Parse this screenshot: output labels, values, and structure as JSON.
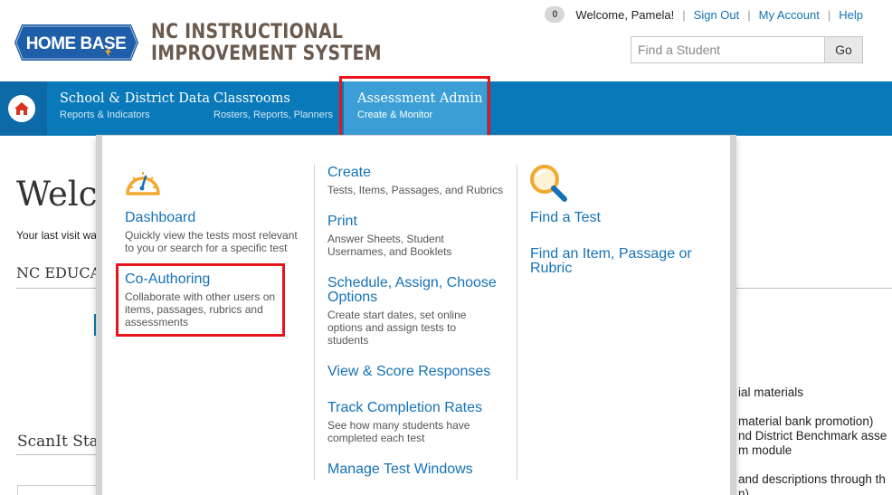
{
  "header": {
    "logo_text": "HOME BASE",
    "system_title_line1": "NC INSTRUCTIONAL",
    "system_title_line2": "IMPROVEMENT SYSTEM",
    "notification_count": "0",
    "welcome_text": "Welcome, Pamela!",
    "links": {
      "sign_out": "Sign Out",
      "my_account": "My Account",
      "help": "Help"
    },
    "separator": "|",
    "search": {
      "placeholder": "Find a Student",
      "button_label": "Go"
    }
  },
  "nav": {
    "items": [
      {
        "title": "School & District Data",
        "subtitle": "Reports & Indicators"
      },
      {
        "title": "Classrooms",
        "subtitle": "Rosters, Reports, Planners"
      },
      {
        "title": "Assessment Admin",
        "subtitle": "Create & Monitor"
      }
    ],
    "active_index": 2
  },
  "background_page": {
    "heading": "Welc",
    "last_visit": "Your last visit wa",
    "nc_section": "NC EDUCA",
    "scanit": "ScanIt Sta",
    "right_text": [
      "ial materials",
      "material bank promotion)",
      "nd District Benchmark asse",
      "m module",
      "and descriptions through th",
      "n)"
    ]
  },
  "dropdown": {
    "col1": {
      "icon": "speedometer-icon",
      "dashboard": {
        "title": "Dashboard",
        "desc_line1": "Quickly view the tests most relevant",
        "desc_line2": "to you or search for a specific test"
      },
      "coauthoring": {
        "title": "Co-Authoring",
        "desc_line1": "Collaborate with other users on",
        "desc_line2": "items, passages, rubrics and",
        "desc_line3": "assessments"
      }
    },
    "col2": {
      "create": {
        "title": "Create",
        "desc_line1": "Tests, Items, Passages, and Rubrics"
      },
      "print": {
        "title": "Print",
        "desc_line1": "Answer Sheets, Student",
        "desc_line2": "Usernames, and Booklets"
      },
      "schedule": {
        "title_line1": "Schedule, Assign, Choose",
        "title_line2": "Options",
        "desc_line1": "Create start dates, set online",
        "desc_line2": "options and assign tests to",
        "desc_line3": "students"
      },
      "view_score": {
        "title": "View & Score Responses"
      },
      "track": {
        "title": "Track Completion Rates",
        "desc_line1": "See how many students have",
        "desc_line2": "completed each test"
      },
      "manage": {
        "title": "Manage Test Windows"
      }
    },
    "col3": {
      "icon": "magnifier-icon",
      "find_test": {
        "title": "Find a Test"
      },
      "find_item": {
        "title_line1": "Find an Item, Passage or",
        "title_line2": "Rubric"
      }
    }
  },
  "colors": {
    "nav_blue": "#0a79b9",
    "active_tab": "#3b9fd6",
    "link_blue": "#1572b6",
    "highlight_red": "#e8141c",
    "icon_gold": "#f0a830"
  }
}
